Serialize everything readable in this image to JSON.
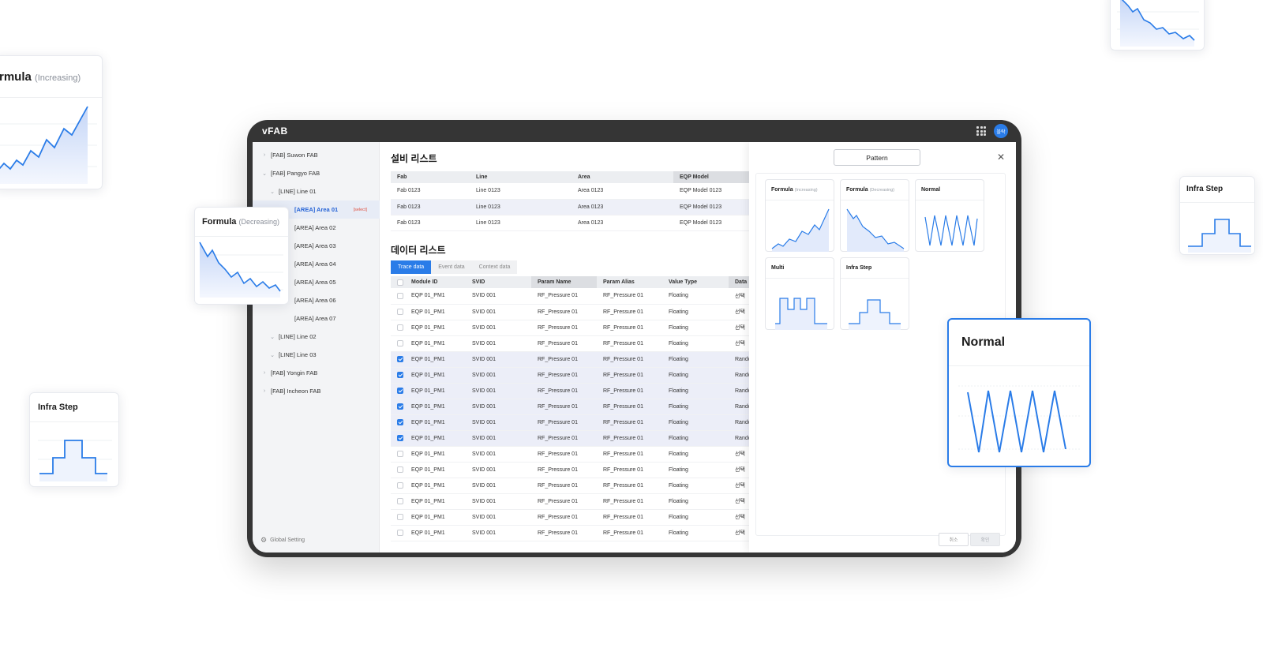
{
  "app": {
    "logo": "vFAB",
    "avatar_label": "블락"
  },
  "colors": {
    "accent": "#2a7ce8",
    "select_tag": "#e0503f"
  },
  "floating_cards": {
    "formula_increasing": {
      "title": "rmula",
      "subtitle": "(Increasing)"
    },
    "formula_decreasing": {
      "title": "Formula",
      "subtitle": "(Decreasing)"
    },
    "infra_step_left": {
      "title": "Infra Step"
    },
    "infra_step_right": {
      "title": "Infra Step"
    },
    "normal_big": {
      "title": "Normal"
    }
  },
  "sidebar": {
    "items": [
      {
        "label": "[FAB] Suwon FAB",
        "chev": "›"
      },
      {
        "label": "[FAB] Pangyo FAB",
        "chev": "⌄"
      },
      {
        "label": "[LINE] Line 01",
        "chev": "⌄"
      },
      {
        "label": "[AREA] Area 01",
        "chev": "",
        "tag": "[select]"
      },
      {
        "label": "[AREA] Area 02",
        "chev": ""
      },
      {
        "label": "[AREA] Area 03",
        "chev": ""
      },
      {
        "label": "[AREA] Area 04",
        "chev": ""
      },
      {
        "label": "[AREA] Area 05",
        "chev": ""
      },
      {
        "label": "[AREA] Area 06",
        "chev": ""
      },
      {
        "label": "[AREA] Area 07",
        "chev": ""
      },
      {
        "label": "[LINE] Line 02",
        "chev": "⌄"
      },
      {
        "label": "[LINE] Line 03",
        "chev": "⌄"
      },
      {
        "label": "[FAB] Yongin FAB",
        "chev": "›"
      },
      {
        "label": "[FAB] Incheon FAB",
        "chev": "›"
      }
    ],
    "global_setting": "Global Setting"
  },
  "equipment": {
    "title": "설비 리스트",
    "headers": [
      "Fab",
      "Line",
      "Area",
      "EQP Model"
    ],
    "rows": [
      [
        "Fab 0123",
        "Line 0123",
        "Area 0123",
        "EQP Model 0123"
      ],
      [
        "Fab 0123",
        "Line 0123",
        "Area 0123",
        "EQP Model 0123"
      ],
      [
        "Fab 0123",
        "Line 0123",
        "Area 0123",
        "EQP Model 0123"
      ]
    ]
  },
  "data_list": {
    "title": "데이터 리스트",
    "tabs": [
      "Trace data",
      "Event data",
      "Context data"
    ],
    "headers": [
      "Module ID",
      "SVID",
      "Param Name",
      "Param Alias",
      "Value Type",
      "Data"
    ],
    "rows": [
      {
        "checked": false,
        "cells": [
          "EQP 01_PM1",
          "SVID 001",
          "RF_Pressure 01",
          "RF_Pressure 01",
          "Floating",
          "선택"
        ]
      },
      {
        "checked": false,
        "cells": [
          "EQP 01_PM1",
          "SVID 001",
          "RF_Pressure 01",
          "RF_Pressure 01",
          "Floating",
          "선택"
        ]
      },
      {
        "checked": false,
        "cells": [
          "EQP 01_PM1",
          "SVID 001",
          "RF_Pressure 01",
          "RF_Pressure 01",
          "Floating",
          "선택"
        ]
      },
      {
        "checked": false,
        "cells": [
          "EQP 01_PM1",
          "SVID 001",
          "RF_Pressure 01",
          "RF_Pressure 01",
          "Floating",
          "선택"
        ]
      },
      {
        "checked": true,
        "cells": [
          "EQP 01_PM1",
          "SVID 001",
          "RF_Pressure 01",
          "RF_Pressure 01",
          "Floating",
          "Rando"
        ]
      },
      {
        "checked": true,
        "cells": [
          "EQP 01_PM1",
          "SVID 001",
          "RF_Pressure 01",
          "RF_Pressure 01",
          "Floating",
          "Rando"
        ]
      },
      {
        "checked": true,
        "cells": [
          "EQP 01_PM1",
          "SVID 001",
          "RF_Pressure 01",
          "RF_Pressure 01",
          "Floating",
          "Rando"
        ]
      },
      {
        "checked": true,
        "cells": [
          "EQP 01_PM1",
          "SVID 001",
          "RF_Pressure 01",
          "RF_Pressure 01",
          "Floating",
          "Rando"
        ]
      },
      {
        "checked": true,
        "cells": [
          "EQP 01_PM1",
          "SVID 001",
          "RF_Pressure 01",
          "RF_Pressure 01",
          "Floating",
          "Rando"
        ]
      },
      {
        "checked": true,
        "cells": [
          "EQP 01_PM1",
          "SVID 001",
          "RF_Pressure 01",
          "RF_Pressure 01",
          "Floating",
          "Rando"
        ]
      },
      {
        "checked": false,
        "cells": [
          "EQP 01_PM1",
          "SVID 001",
          "RF_Pressure 01",
          "RF_Pressure 01",
          "Floating",
          "선택"
        ]
      },
      {
        "checked": false,
        "cells": [
          "EQP 01_PM1",
          "SVID 001",
          "RF_Pressure 01",
          "RF_Pressure 01",
          "Floating",
          "선택"
        ]
      },
      {
        "checked": false,
        "cells": [
          "EQP 01_PM1",
          "SVID 001",
          "RF_Pressure 01",
          "RF_Pressure 01",
          "Floating",
          "선택"
        ]
      },
      {
        "checked": false,
        "cells": [
          "EQP 01_PM1",
          "SVID 001",
          "RF_Pressure 01",
          "RF_Pressure 01",
          "Floating",
          "선택"
        ]
      },
      {
        "checked": false,
        "cells": [
          "EQP 01_PM1",
          "SVID 001",
          "RF_Pressure 01",
          "RF_Pressure 01",
          "Floating",
          "선택"
        ]
      },
      {
        "checked": false,
        "cells": [
          "EQP 01_PM1",
          "SVID 001",
          "RF_Pressure 01",
          "RF_Pressure 01",
          "Floating",
          "선택"
        ]
      }
    ]
  },
  "pattern_panel": {
    "button_label": "Pattern",
    "close_icon": "close-icon",
    "cards": [
      {
        "title": "Formula",
        "sub": "(Increasing)",
        "kind": "increasing"
      },
      {
        "title": "Formula",
        "sub": "(Decreasing)",
        "kind": "decreasing"
      },
      {
        "title": "Normal",
        "sub": "",
        "kind": "normal"
      },
      {
        "title": "Multi",
        "sub": "",
        "kind": "multi"
      },
      {
        "title": "Infra Step",
        "sub": "",
        "kind": "step"
      }
    ],
    "cancel_label": "취소",
    "confirm_label": "확인"
  }
}
